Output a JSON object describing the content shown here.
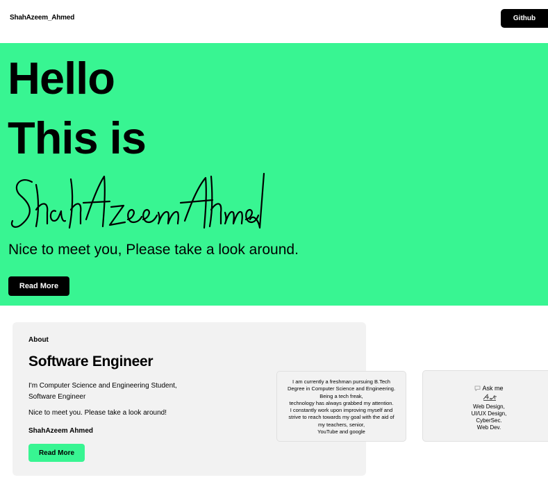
{
  "nav": {
    "brand": "ShahAzeem_Ahmed",
    "github_label": "Github"
  },
  "hero": {
    "line1": "Hello",
    "line2": "This is",
    "signature_name": "ShahAzeem Ahmed",
    "tagline": "Nice to meet you, Please take a  look around.",
    "read_more": "Read More"
  },
  "about": {
    "label": "About",
    "title": "Software Engineer",
    "desc_line1": "I'm Computer Science and Engineering Student,",
    "desc_line2": "Software Engineer",
    "nice": "Nice to meet you. Please take a look around!",
    "name": "ShahAzeem Ahmed",
    "read_more": "Read More"
  },
  "bio": {
    "lines": [
      "I am currently a freshman pursuing B.Tech",
      "Degree in Computer Science and Engineering.",
      "Being a tech freak,",
      "technology has always grabbed my attention.",
      "I constantly work upon improving myself and",
      "strive to reach towards my goal with the aid of",
      "my teachers, senior,",
      "YouTube and google"
    ]
  },
  "askme": {
    "icon": "speech-bubble-icon",
    "heading": "Ask me",
    "signature_text": "About",
    "skills": [
      "Web Design,",
      "UI/UX Design,",
      "CyberSec.",
      "Web Dev."
    ]
  },
  "colors": {
    "accent": "#38f592",
    "card": "#f2f2f2",
    "dark": "#000000"
  }
}
